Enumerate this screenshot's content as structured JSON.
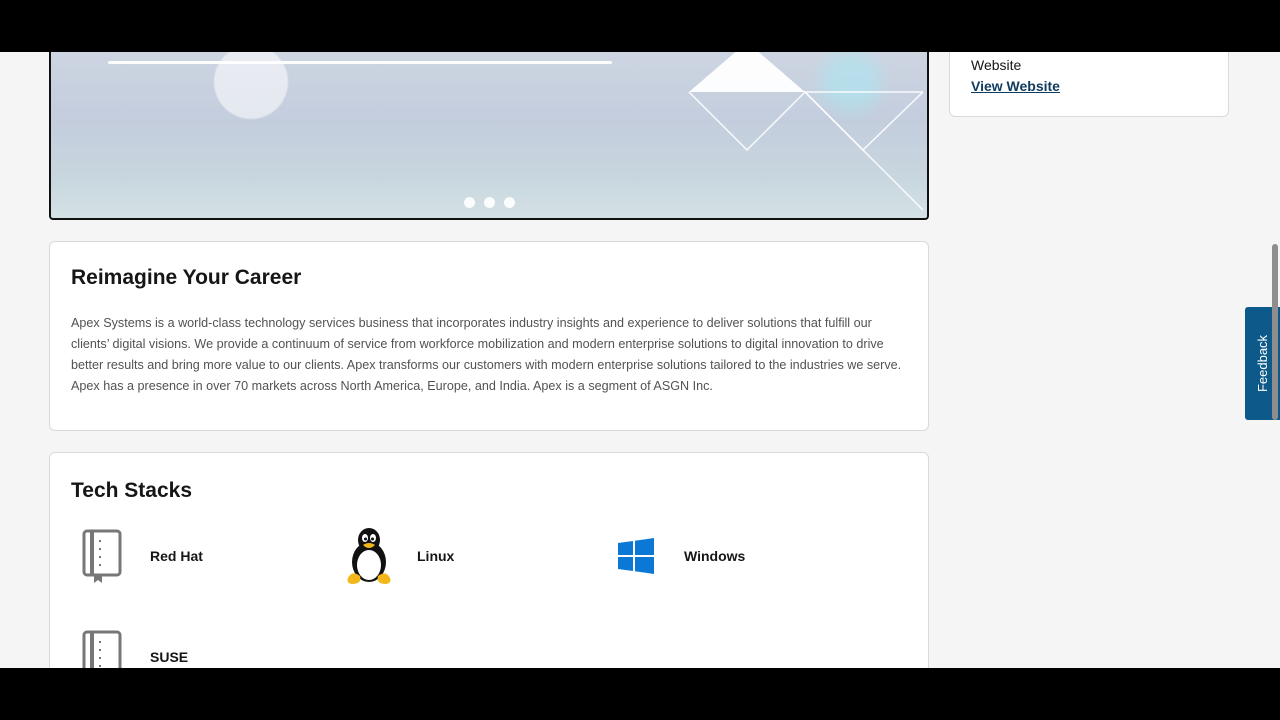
{
  "banner": {
    "carousel_dots": 3
  },
  "about": {
    "title": "Reimagine Your Career",
    "description": "Apex Systems is a world-class technology services business that incorporates industry insights and experience to deliver solutions that fulfill our clients’ digital visions. We provide a continuum of service from workforce mobilization and modern enterprise solutions to digital innovation to drive better results and bring more value to our clients. Apex transforms our customers with modern enterprise solutions tailored to the industries we serve. Apex has a presence in over 70 markets across North America, Europe, and India. Apex is a segment of ASGN Inc."
  },
  "tech_stacks": {
    "title": "Tech Stacks",
    "items": [
      {
        "label": "Red Hat",
        "icon": "book-icon"
      },
      {
        "label": "Linux",
        "icon": "linux-penguin-icon"
      },
      {
        "label": "Windows",
        "icon": "windows-logo-icon"
      },
      {
        "label": "SUSE",
        "icon": "book-icon"
      }
    ]
  },
  "sidebar": {
    "website_label": "Website",
    "website_link": "View Website"
  },
  "feedback": {
    "label": "Feedback"
  },
  "colors": {
    "link": "#0f3b5f",
    "feedback_bg": "#0d5a8a",
    "windows_blue": "#0a78d4"
  }
}
